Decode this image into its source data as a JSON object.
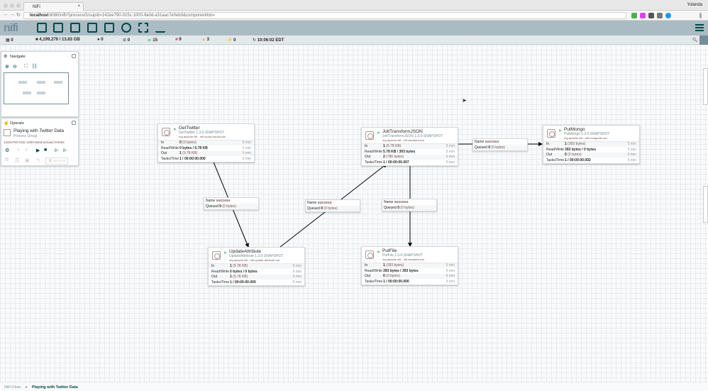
{
  "browser": {
    "tab_title": "NiFi",
    "user": "Yolanda",
    "url_host": "localhost",
    "url_rest": ":8080/nifi/?processGroupId=142ee790-015c-1000-9a0d-a31aac7e0eb3&componentIds="
  },
  "header": {
    "logo": "nifi",
    "menu_icon": "hamburger-icon"
  },
  "status": {
    "active_threads": "0",
    "queued": "4,199,279 / 13.83 GB",
    "transmitting": "0",
    "not_transmitting": "0",
    "running": "15",
    "stopped": "9",
    "invalid": "3",
    "disabled": "0",
    "refresh_time": "10:06:02 EDT"
  },
  "navigate": {
    "title": "Navigate"
  },
  "operate": {
    "title": "Operate",
    "name": "Playing with Twitter Data",
    "type": "Process Group",
    "id": "142ee790-015c-1000-9a0d-a31aac7e0eb3",
    "delete_label": "DELETE"
  },
  "labels": {
    "in": "In",
    "rw": "Read/Write",
    "out": "Out",
    "tasks": "Tasks/Time",
    "window": "5 min",
    "conn_name": "Name",
    "conn_queued": "Queued"
  },
  "processors": [
    {
      "name": "GetTwitter",
      "type": "GetTwitter 1.3.0-SNAPSHOT",
      "bundle": "org.apache.nifi - nifi-social-media-nar",
      "in": "0",
      "in_d": "(0 bytes)",
      "rw": "0 bytes / 5.78 KB",
      "out": "1",
      "out_d": "(5.78 KB)",
      "tasks": "1 / 00:00:00.000",
      "status": "running"
    },
    {
      "name": "JoltTransformJSON",
      "type": "JoltTransformJSON 1.3.0-SNAPSHOT",
      "bundle": "org.apache.nifi - nifi-standard-nar",
      "in": "1",
      "in_d": "(5.78 KB)",
      "rw": "5.78 KB / 393 bytes",
      "out": "2",
      "out_d": "(786 bytes)",
      "tasks": "1 / 00:00:00.007",
      "status": "running"
    },
    {
      "name": "PutMongo",
      "type": "PutMongo 1.3.0-SNAPSHOT",
      "bundle": "org.apache.nifi - nifi-mongodb-nar",
      "in": "1",
      "in_d": "(393 bytes)",
      "rw": "393 bytes / 0 bytes",
      "out": "0",
      "out_d": "(0 bytes)",
      "tasks": "1 / 00:00:00.002",
      "status": "running"
    },
    {
      "name": "UpdateAttribute",
      "type": "UpdateAttribute 1.3.0-SNAPSHOT",
      "bundle": "org.apache.nifi - nifi-update-attribute-nar",
      "in": "1",
      "in_d": "(5.78 KB)",
      "rw": "0 bytes / 0 bytes",
      "out": "1",
      "out_d": "(5.78 KB)",
      "tasks": "1 / 00:00:00.000",
      "status": "running"
    },
    {
      "name": "PutFile",
      "type": "PutFile 1.3.0-SNAPSHOT",
      "bundle": "org.apache.nifi - nifi-standard-nar",
      "in": "1",
      "in_d": "(393 bytes)",
      "rw": "393 bytes / 393 bytes",
      "out": "0",
      "out_d": "(0 bytes)",
      "tasks": "1 / 00:00:00.000",
      "status": "running"
    }
  ],
  "connections": [
    {
      "name": "success",
      "queued": "0",
      "queued_d": "(0 bytes)"
    },
    {
      "name": "success",
      "queued": "0",
      "queued_d": "(0 bytes)"
    },
    {
      "name": "success",
      "queued": "0",
      "queued_d": "(0 bytes)"
    },
    {
      "name": "success",
      "queued": "0",
      "queued_d": "(0 bytes)"
    }
  ],
  "breadcrumb": {
    "root": "NiFi Flow",
    "sep": "»",
    "current": "Playing with Twitter Data"
  },
  "colors": {
    "header": "#aabbc3",
    "accent": "#004849",
    "running": "#7dc7a0",
    "stopped": "#d9534f",
    "invalid": "#f0ad4e"
  }
}
